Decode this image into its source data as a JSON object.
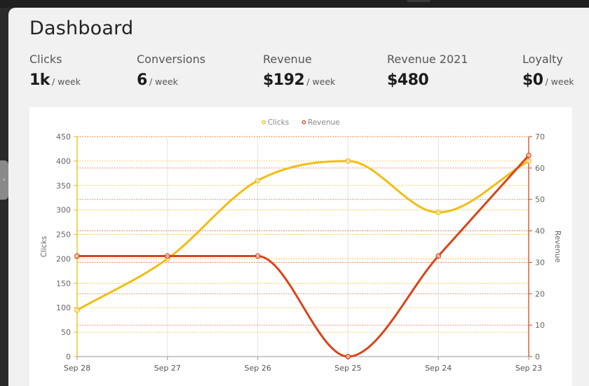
{
  "page": {
    "title": "Dashboard"
  },
  "stats": [
    {
      "label": "Clicks",
      "value": "1k",
      "unit": "/ week"
    },
    {
      "label": "Conversions",
      "value": "6",
      "unit": "/ week"
    },
    {
      "label": "Revenue",
      "value": "$192",
      "unit": "/ week"
    },
    {
      "label": "Revenue 2021",
      "value": "$480",
      "unit": ""
    },
    {
      "label": "Loyalty",
      "value": "$0",
      "unit": "/ week"
    }
  ],
  "sidebar": {
    "collapse_glyph": "‹"
  },
  "chart_data": {
    "type": "line",
    "categories": [
      "Sep 28",
      "Sep 27",
      "Sep 26",
      "Sep 25",
      "Sep 24",
      "Sep 23"
    ],
    "series": [
      {
        "name": "Clicks",
        "axis": "left",
        "color": "#f2bd12",
        "values": [
          95,
          200,
          360,
          400,
          295,
          400
        ]
      },
      {
        "name": "Revenue",
        "axis": "right",
        "color": "#d9441a",
        "values": [
          32,
          32,
          32,
          0,
          32,
          64
        ]
      }
    ],
    "ylabel": "Clicks",
    "y2label": "Revenue",
    "ylim": [
      0,
      450
    ],
    "y2lim": [
      0,
      70
    ],
    "yticks": [
      0,
      50,
      100,
      150,
      200,
      250,
      300,
      350,
      400,
      450
    ],
    "y2ticks": [
      0,
      10,
      20,
      30,
      40,
      50,
      60,
      70
    ],
    "grid": true,
    "legend": "top-center",
    "colors": {
      "left_axis": "#f2bd12",
      "right_axis": "#d9441a"
    }
  }
}
